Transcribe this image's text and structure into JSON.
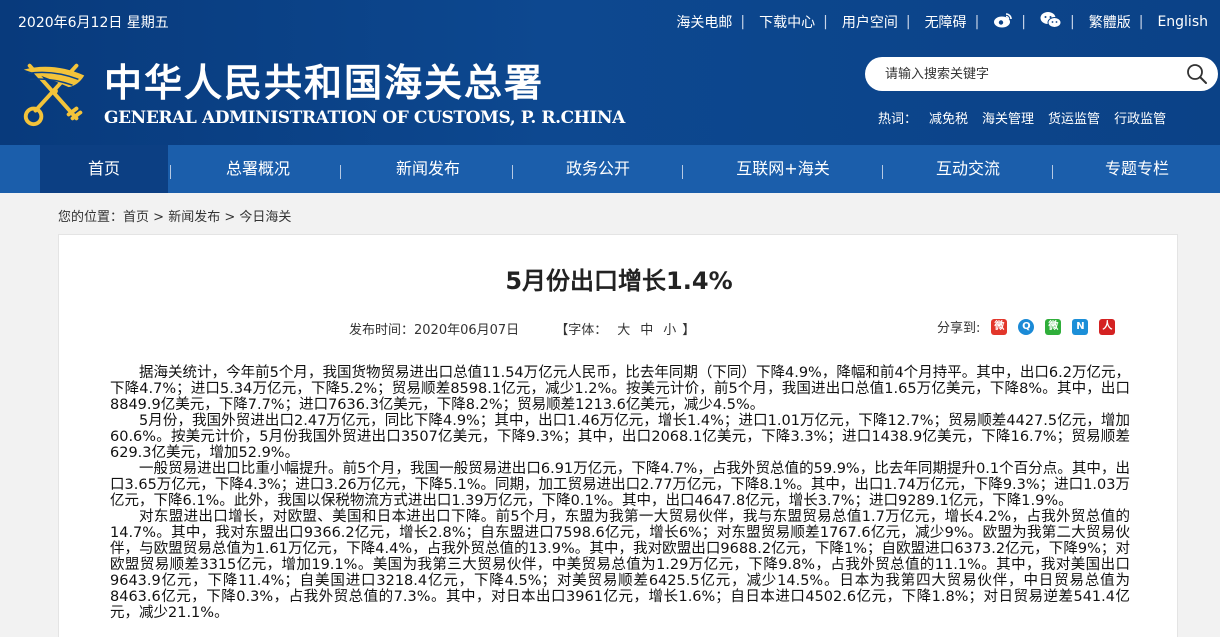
{
  "header": {
    "date": "2020年6月12日 星期五",
    "links": [
      "海关电邮",
      "下载中心",
      "用户空间",
      "无障碍"
    ],
    "icons": [
      "weibo-icon",
      "wechat-icon"
    ],
    "lang_links": [
      "繁體版",
      "English"
    ],
    "cn_title": "中华人民共和国海关总署",
    "en_title": "GENERAL ADMINISTRATION OF CUSTOMS, P. R.CHINA",
    "search_placeholder": "请输入搜索关键字",
    "hot_label": "热词：",
    "hot_words": [
      "减免税",
      "海关管理",
      "货运监管",
      "行政监管"
    ]
  },
  "nav": {
    "items": [
      "首页",
      "总署概况",
      "新闻发布",
      "政务公开",
      "互联网+海关",
      "互动交流",
      "专题专栏"
    ],
    "active": "首页"
  },
  "breadcrumb": {
    "label": "您的位置：",
    "items": [
      "首页",
      "新闻发布",
      "今日海关"
    ],
    "sep": " > "
  },
  "article": {
    "title": "5月份出口增长1.4%",
    "publish_label": "发布时间：",
    "publish_date": "2020年06月07日",
    "font_label": "【字体：",
    "font_sizes": [
      "大",
      "中",
      "小"
    ],
    "font_close": "】",
    "share_label": "分享到:",
    "paragraphs": [
      "据海关统计，今年前5个月，我国货物贸易进出口总值11.54万亿元人民币，比去年同期（下同）下降4.9%，降幅和前4个月持平。其中，出口6.2万亿元，下降4.7%；进口5.34万亿元，下降5.2%；贸易顺差8598.1亿元，减少1.2%。按美元计价，前5个月，我国进出口总值1.65万亿美元，下降8%。其中，出口8849.9亿美元，下降7.7%；进口7636.3亿美元，下降8.2%；贸易顺差1213.6亿美元，减少4.5%。",
      "5月份，我国外贸进出口2.47万亿元，同比下降4.9%；其中，出口1.46万亿元，增长1.4%；进口1.01万亿元，下降12.7%；贸易顺差4427.5亿元，增加60.6%。按美元计价，5月份我国外贸进出口3507亿美元，下降9.3%；其中，出口2068.1亿美元，下降3.3%；进口1438.9亿美元，下降16.7%；贸易顺差629.3亿美元，增加52.9%。",
      "一般贸易进出口比重小幅提升。前5个月，我国一般贸易进出口6.91万亿元，下降4.7%，占我外贸总值的59.9%，比去年同期提升0.1个百分点。其中，出口3.65万亿元，下降4.3%；进口3.26万亿元，下降5.1%。同期，加工贸易进出口2.77万亿元，下降8.1%。其中，出口1.74万亿元，下降9.3%；进口1.03万亿元，下降6.1%。此外，我国以保税物流方式进出口1.39万亿元，下降0.1%。其中，出口4647.8亿元，增长3.7%；进口9289.1亿元，下降1.9%。",
      "对东盟进出口增长，对欧盟、美国和日本进出口下降。前5个月，东盟为我第一大贸易伙伴，我与东盟贸易总值1.7万亿元，增长4.2%，占我外贸总值的14.7%。其中，我对东盟出口9366.2亿元，增长2.8%；自东盟进口7598.6亿元，增长6%；对东盟贸易顺差1767.6亿元，减少9%。欧盟为我第二大贸易伙伴，与欧盟贸易总值为1.61万亿元，下降4.4%，占我外贸总值的13.9%。其中，我对欧盟出口9688.2亿元，下降1%；自欧盟进口6373.2亿元，下降9%；对欧盟贸易顺差3315亿元，增加19.1%。美国为我第三大贸易伙伴，中美贸易总值为1.29万亿元，下降9.8%，占我外贸总值的11.1%。其中，我对美国出口9643.9亿元，下降11.4%；自美国进口3218.4亿元，下降4.5%；对美贸易顺差6425.5亿元，减少14.5%。日本为我第四大贸易伙伴，中日贸易总值为8463.6亿元，下降0.3%，占我外贸总值的7.3%。其中，对日本出口3961亿元，增长1.6%；自日本进口4502.6亿元，下降1.8%；对日贸易逆差541.4亿元，减少21.1%。"
    ]
  },
  "colors": {
    "header_bg": "#0b4287",
    "nav_bg": "#1b5eab",
    "nav_active_bg": "#0c3f83",
    "page_bg": "#f2f2f2"
  }
}
